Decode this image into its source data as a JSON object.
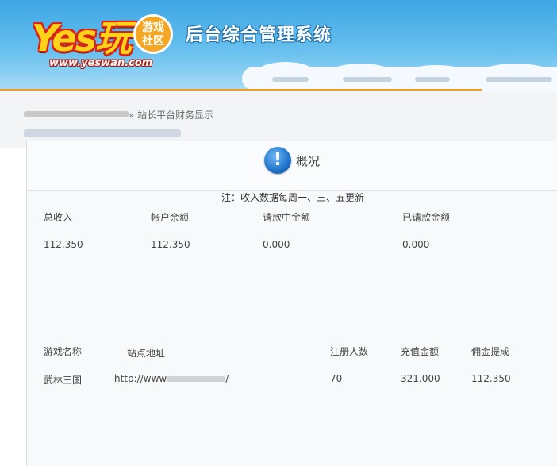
{
  "header": {
    "logo_text": "Yes玩",
    "logo_badge": "游戏\n社区",
    "logo_url": "www.yeswan.com",
    "system_title": "后台综合管理系统"
  },
  "breadcrumb": {
    "current": "» 站长平台财务显示"
  },
  "panel": {
    "icon": "info-icon",
    "title": "概况",
    "note": "注：收入数据每周一、三、五更新"
  },
  "summary": {
    "headers": [
      "总收入",
      "帐户余额",
      "请款中金额",
      "已请款金额"
    ],
    "values": [
      "112.350",
      "112.350",
      "0.000",
      "0.000"
    ]
  },
  "games": {
    "headers": [
      "游戏名称",
      "站点地址",
      "注册人数",
      "充值金额",
      "佣金提成"
    ],
    "rows": [
      [
        "武林三国",
        "http://www",
        "70",
        "321.000",
        "112.350"
      ]
    ],
    "url_suffix": "/"
  }
}
